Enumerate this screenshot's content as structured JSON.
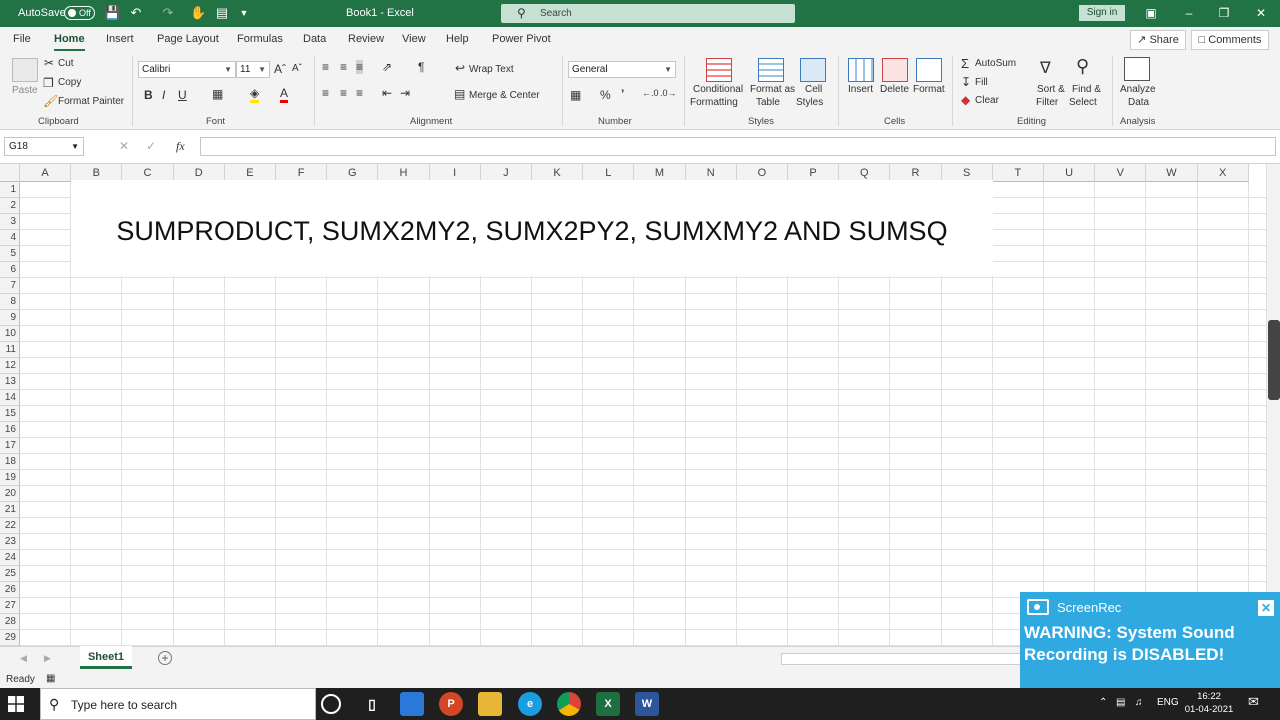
{
  "titlebar": {
    "autosave_label": "AutoSave",
    "autosave_state": "Off",
    "doc_title": "Book1  -  Excel",
    "search_placeholder": "Search",
    "signin_label": "Sign in"
  },
  "menu": {
    "tabs": [
      "File",
      "Home",
      "Insert",
      "Page Layout",
      "Formulas",
      "Data",
      "Review",
      "View",
      "Help",
      "Power Pivot"
    ],
    "active_tab": "Home",
    "share_label": "Share",
    "comments_label": "Comments"
  },
  "ribbon": {
    "clipboard": {
      "paste": "Paste",
      "cut": "Cut",
      "copy": "Copy",
      "format_painter": "Format Painter",
      "label": "Clipboard"
    },
    "font": {
      "name": "Calibri",
      "size": "11",
      "bold": "B",
      "italic": "I",
      "underline": "U",
      "label": "Font"
    },
    "alignment": {
      "wrap_text": "Wrap Text",
      "merge_center": "Merge & Center",
      "label": "Alignment"
    },
    "number": {
      "format": "General",
      "percent": "%",
      "label": "Number"
    },
    "styles": {
      "conditional_1": "Conditional",
      "conditional_2": "Formatting",
      "format_table_1": "Format as",
      "format_table_2": "Table",
      "cell_styles_1": "Cell",
      "cell_styles_2": "Styles",
      "label": "Styles"
    },
    "cells": {
      "insert": "Insert",
      "delete": "Delete",
      "format": "Format",
      "label": "Cells"
    },
    "editing": {
      "autosum": "AutoSum",
      "fill": "Fill",
      "clear": "Clear",
      "sort_filter_1": "Sort &",
      "sort_filter_2": "Filter",
      "find_select_1": "Find &",
      "find_select_2": "Select",
      "label": "Editing"
    },
    "analysis": {
      "analyze_1": "Analyze",
      "analyze_2": "Data",
      "label": "Analysis"
    }
  },
  "formula_bar": {
    "name_box": "G18",
    "fx": "fx",
    "content": ""
  },
  "sheet": {
    "columns": [
      "A",
      "B",
      "C",
      "D",
      "E",
      "F",
      "G",
      "H",
      "I",
      "J",
      "K",
      "L",
      "M",
      "N",
      "O",
      "P",
      "Q",
      "R",
      "S",
      "T",
      "U",
      "V",
      "W",
      "X"
    ],
    "rows": [
      "1",
      "2",
      "3",
      "4",
      "5",
      "6",
      "7",
      "8",
      "9",
      "10",
      "11",
      "12",
      "13",
      "14",
      "15",
      "16",
      "17",
      "18",
      "19",
      "20",
      "21",
      "22",
      "23",
      "24",
      "25",
      "26",
      "27",
      "28",
      "29"
    ],
    "title_text": "SUMPRODUCT, SUMX2MY2, SUMX2PY2, SUMXMY2 AND SUMSQ"
  },
  "sheet_tabs": {
    "active": "Sheet1",
    "add": "+"
  },
  "status": {
    "text": "Ready"
  },
  "taskbar": {
    "search_placeholder": "Type here to search",
    "lang": "ENG",
    "time": "16:22",
    "date": "01-04-2021"
  },
  "screenrec": {
    "brand": "ScreenRec",
    "warning": "WARNING: System Sound Recording is DISABLED!"
  },
  "colors": {
    "excel_green": "#217346",
    "screenrec_blue": "#2fa9e0"
  }
}
